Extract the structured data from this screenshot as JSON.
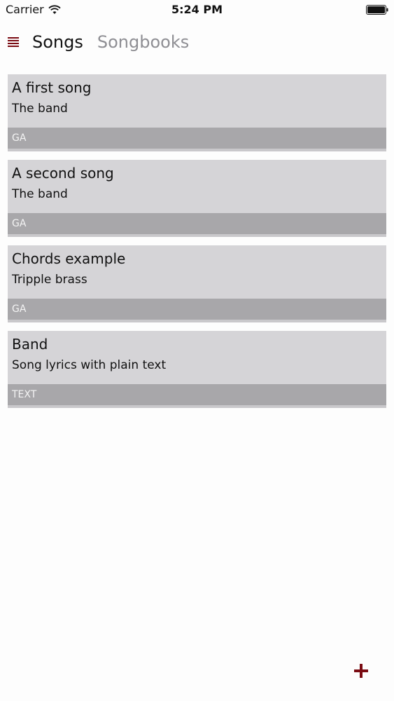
{
  "status_bar": {
    "carrier": "Carrier",
    "time": "5:24 PM"
  },
  "header": {
    "tabs": [
      {
        "label": "Songs",
        "active": true
      },
      {
        "label": "Songbooks",
        "active": false
      }
    ]
  },
  "songs": [
    {
      "title": "A first song",
      "subtitle": "The band",
      "tag": "GA"
    },
    {
      "title": "A second song",
      "subtitle": "The band",
      "tag": "GA"
    },
    {
      "title": "Chords example",
      "subtitle": "Tripple brass",
      "tag": "GA"
    },
    {
      "title": "Band",
      "subtitle": "Song lyrics with plain text",
      "tag": "TEXT"
    }
  ],
  "colors": {
    "accent": "#7a0b12",
    "card": "#d5d4d7",
    "tag_bar": "#a8a7aa",
    "inactive_tab": "#8e8e93"
  },
  "icons": {
    "menu": "menu-icon",
    "add": "plus-icon",
    "wifi": "wifi-icon",
    "battery": "battery-icon"
  }
}
